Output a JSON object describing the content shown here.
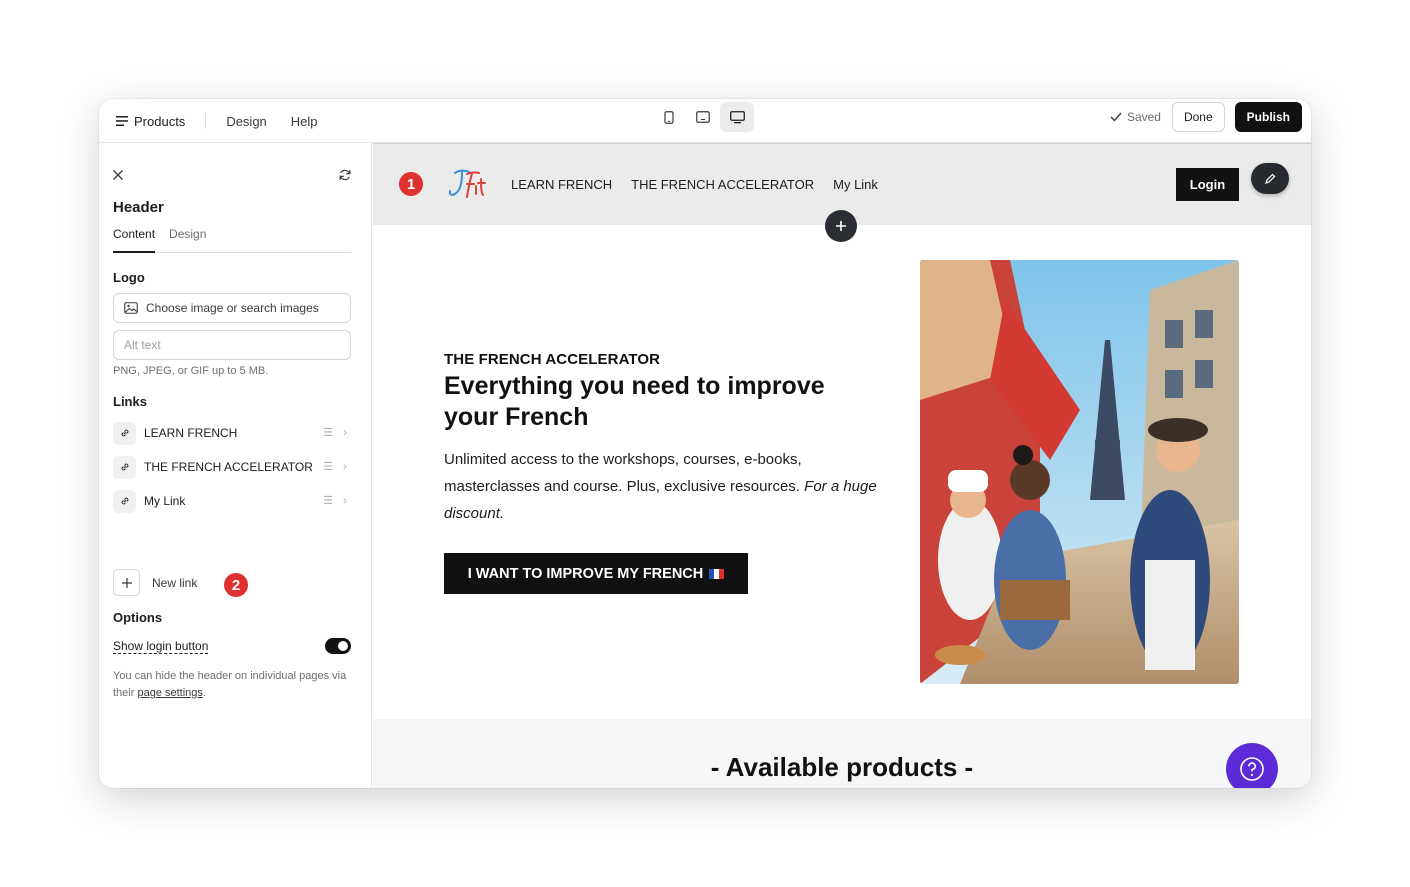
{
  "topbar": {
    "menu_label": "Products",
    "nav": [
      "Design",
      "Help"
    ],
    "saved_label": "Saved",
    "done_label": "Done",
    "publish_label": "Publish"
  },
  "sidebar": {
    "title": "Header",
    "tabs": [
      "Content",
      "Design"
    ],
    "logo_section": "Logo",
    "choose_image": "Choose image or search images",
    "alt_placeholder": "Alt text",
    "file_hint": "PNG, JPEG, or GIF up to 5 MB.",
    "links_section": "Links",
    "links": [
      {
        "label": "LEARN FRENCH"
      },
      {
        "label": "THE FRENCH ACCELERATOR"
      },
      {
        "label": "My Link"
      }
    ],
    "new_link": "New link",
    "options_section": "Options",
    "show_login": "Show login button",
    "options_hint_prefix": "You can hide the header on individual pages via their",
    "options_hint_link": "page settings",
    "options_hint_suffix": "."
  },
  "badges": {
    "one": "1",
    "two": "2"
  },
  "site": {
    "nav": [
      "LEARN FRENCH",
      "THE FRENCH ACCELERATOR",
      "My Link"
    ],
    "login": "Login",
    "hero": {
      "eyebrow": "THE FRENCH ACCELERATOR",
      "title": "Everything you need to improve your French",
      "body": "Unlimited access to the workshops, courses, e-books, masterclasses and course. Plus, exclusive resources.",
      "body_em": "For a huge discount.",
      "cta": "I WANT TO IMPROVE MY FRENCH"
    },
    "products_title": "- Available products -"
  },
  "colors": {
    "accent_dark": "#111111",
    "badge_red": "#e03131",
    "help_purple": "#5b2bd8",
    "header_bg": "#ebebeb"
  }
}
